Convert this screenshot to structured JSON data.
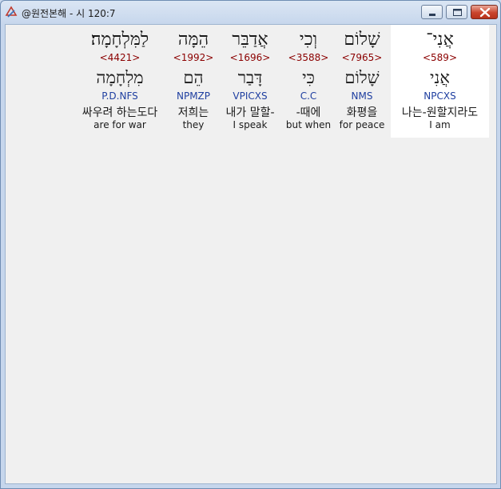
{
  "window": {
    "title": "@원전본해 - 시 120:7"
  },
  "controls": {
    "minimize_icon": "minimize-icon",
    "maximize_icon": "maximize-icon",
    "close_icon": "close-icon"
  },
  "colors": {
    "strong_number": "#8b0000",
    "morphology": "#1f3fa0",
    "selected_background": "#ffffff",
    "client_background": "#f0f0f0"
  },
  "words": [
    {
      "hebrew": "אֲנִי־",
      "strong": "<589>",
      "lemma": "אֲנִי",
      "morph": "NPCXS",
      "korean": "나는-원할지라도",
      "english": "I am",
      "selected": true
    },
    {
      "hebrew": "שָׁלוֹם",
      "strong": "<7965>",
      "lemma": "שָׁלוֹם",
      "morph": "NMS",
      "korean": "화평을",
      "english": "for peace",
      "selected": false
    },
    {
      "hebrew": "וְכִי",
      "strong": "<3588>",
      "lemma": "כִּי",
      "morph": "C.C",
      "korean": "-때에",
      "english": "but when",
      "selected": false
    },
    {
      "hebrew": "אֲדַבֵּר",
      "strong": "<1696>",
      "lemma": "דָּבַר",
      "morph": "VPICXS",
      "korean": "내가 말할-",
      "english": "I speak",
      "selected": false
    },
    {
      "hebrew": "הֵמָּה",
      "strong": "<1992>",
      "lemma": "הֵם",
      "morph": "NPMZP",
      "korean": "저희는",
      "english": "they",
      "selected": false
    },
    {
      "hebrew": "לַמִּלְחָמָה׃",
      "strong": "<4421>",
      "lemma": "מִלְחָמָה",
      "morph": "P.D.NFS",
      "korean": "싸우려 하는도다",
      "english": "are for war",
      "selected": false
    }
  ]
}
